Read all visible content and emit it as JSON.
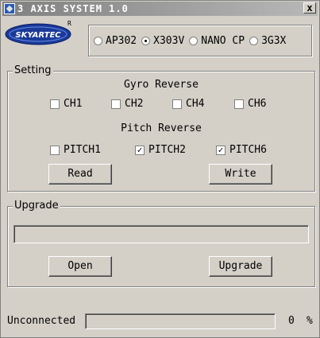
{
  "window": {
    "title": "3 AXIS SYSTEM 1.0",
    "close_label": "x"
  },
  "logo": {
    "text": "SKYARTEC",
    "mark": "R"
  },
  "models": [
    {
      "label": "AP302",
      "checked": false
    },
    {
      "label": "X303V",
      "checked": true
    },
    {
      "label": "NANO CP",
      "checked": false
    },
    {
      "label": "3G3X",
      "checked": false
    }
  ],
  "setting": {
    "title": "Setting",
    "gyro_reverse_label": "Gyro Reverse",
    "gyro": [
      {
        "label": "CH1",
        "checked": false
      },
      {
        "label": "CH2",
        "checked": false
      },
      {
        "label": "CH4",
        "checked": false
      },
      {
        "label": "CH6",
        "checked": false
      }
    ],
    "pitch_reverse_label": "Pitch Reverse",
    "pitch": [
      {
        "label": "PITCH1",
        "checked": false
      },
      {
        "label": "PITCH2",
        "checked": true
      },
      {
        "label": "PITCH6",
        "checked": true
      }
    ],
    "read_label": "Read",
    "write_label": "Write"
  },
  "upgrade": {
    "title": "Upgrade",
    "progress": 0,
    "open_label": "Open",
    "upgrade_label": "Upgrade"
  },
  "status": {
    "connection": "Unconnected",
    "progress_value": "0",
    "progress_unit": "%",
    "progress": 0
  }
}
